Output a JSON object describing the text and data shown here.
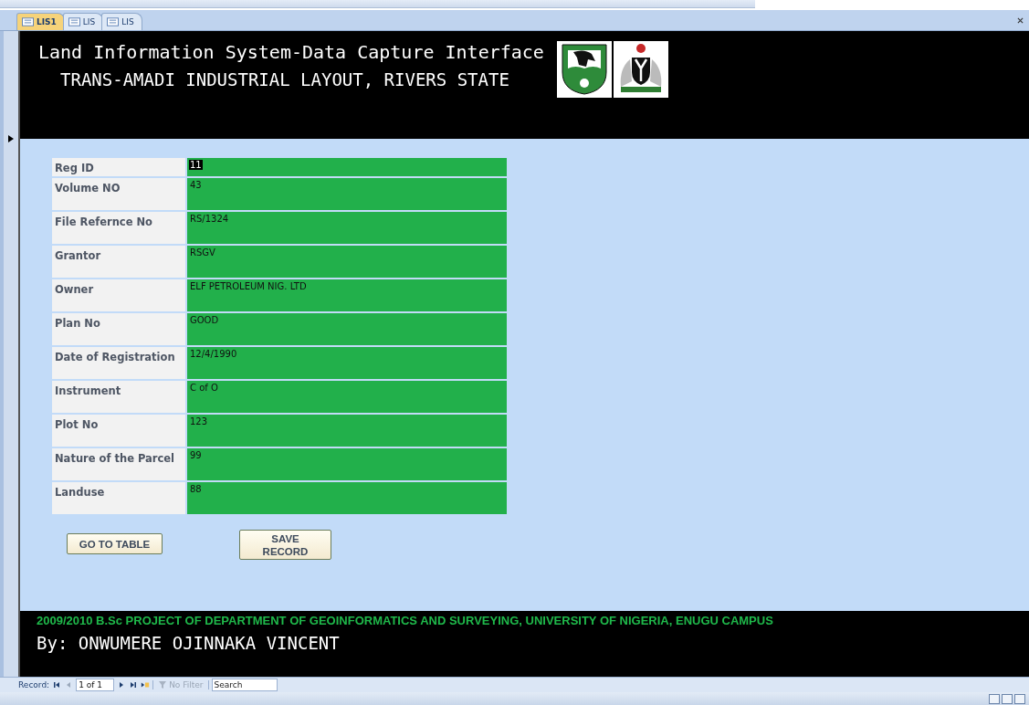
{
  "tabs": [
    {
      "label": "LIS1",
      "selected": true
    },
    {
      "label": "LIS",
      "selected": false
    },
    {
      "label": "LIS",
      "selected": false
    }
  ],
  "header": {
    "title": "Land Information System-Data Capture Interface",
    "subtitle": "TRANS-AMADI INDUSTRIAL LAYOUT, RIVERS STATE"
  },
  "fields": [
    {
      "label": "Reg ID",
      "value": "11",
      "highlighted": true
    },
    {
      "label": "Volume NO",
      "value": "43",
      "highlighted": false
    },
    {
      "label": "File Refernce  No",
      "value": "RS/1324",
      "highlighted": false
    },
    {
      "label": "Grantor",
      "value": "RSGV",
      "highlighted": false
    },
    {
      "label": "Owner",
      "value": "ELF PETROLEUM NIG. LTD",
      "highlighted": false
    },
    {
      "label": "Plan No",
      "value": "GOOD",
      "highlighted": false
    },
    {
      "label": "Date of Registration",
      "value": "12/4/1990",
      "highlighted": false
    },
    {
      "label": "Instrument",
      "value": "C of O",
      "highlighted": false
    },
    {
      "label": "Plot No",
      "value": "123",
      "highlighted": false
    },
    {
      "label": "Nature of the Parcel",
      "value": "99",
      "highlighted": false
    },
    {
      "label": "Landuse",
      "value": "88",
      "highlighted": false
    }
  ],
  "buttons": [
    "GO TO TABLE",
    "SAVE RECORD"
  ],
  "footer": {
    "project": "2009/2010 B.Sc PROJECT OF DEPARTMENT OF GEOINFORMATICS AND SURVEYING, UNIVERSITY OF NIGERIA, ENUGU CAMPUS",
    "author": "By: ONWUMERE OJINNAKA VINCENT"
  },
  "navigation": {
    "label": "Record:",
    "position": "1 of 1",
    "filter": {
      "label": "No Filter",
      "disabled": true
    },
    "search": {
      "placeholder": "Search"
    }
  }
}
